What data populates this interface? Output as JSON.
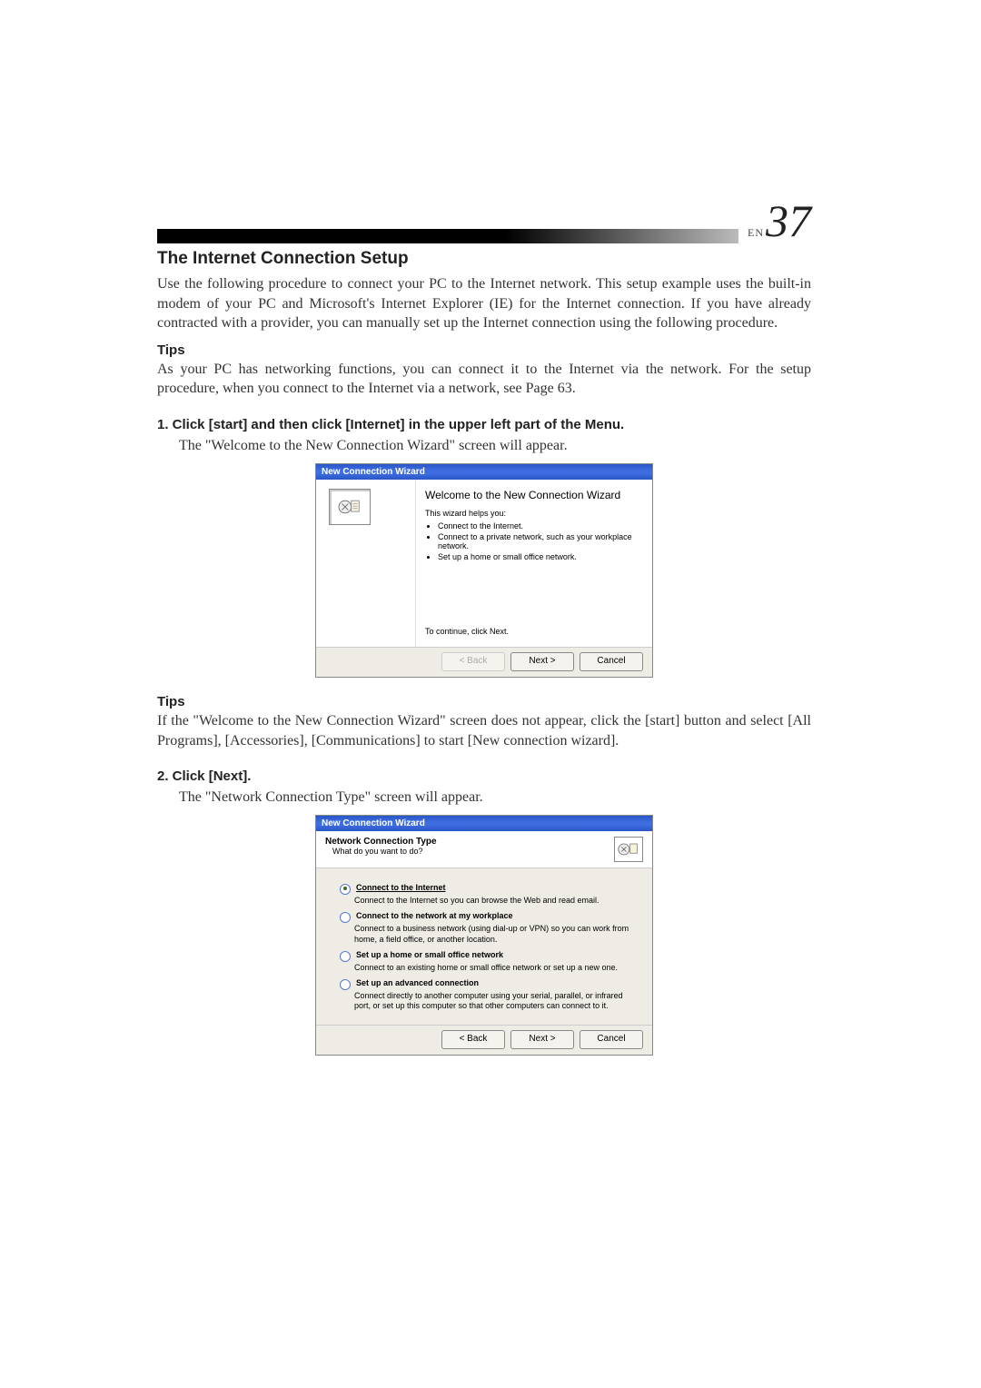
{
  "page": {
    "lang_prefix": "EN",
    "number": "37"
  },
  "section_title": "The Internet Connection Setup",
  "intro": "Use the following procedure to connect your PC to the Internet network.  This setup example uses the built-in modem of your PC and Microsoft's Internet Explorer (IE) for the Internet connection. If you have already contracted with a provider, you can manually set up the Internet connection using the following procedure.",
  "tips1": {
    "head": "Tips",
    "body": "As your PC has networking functions, you can connect it to the Internet via the network.  For the setup procedure, when you connect to the Internet via a network, see Page  63."
  },
  "step1": {
    "head": "1.  Click [start] and then click [Internet] in the upper left part of the Menu.",
    "body": "The \"Welcome to the New Connection Wizard\" screen will appear."
  },
  "wizard1": {
    "titlebar": "New Connection Wizard",
    "heading": "Welcome to the New Connection Wizard",
    "lead": "This wizard helps you:",
    "bullets": [
      "Connect to the Internet.",
      "Connect to a private network, such as your workplace network.",
      "Set up a home or small office network."
    ],
    "continue_line": "To continue, click Next.",
    "buttons": {
      "back": "< Back",
      "next": "Next >",
      "cancel": "Cancel"
    }
  },
  "tips2": {
    "head": "Tips",
    "body": "If the \"Welcome to the New Connection Wizard\" screen does not appear, click the [start] button and select [All Programs], [Accessories], [Communications] to start [New connection wizard]."
  },
  "step2": {
    "head": "2.  Click [Next].",
    "body": "The \"Network Connection Type\" screen will appear."
  },
  "wizard2": {
    "titlebar": "New Connection Wizard",
    "header_title": "Network Connection Type",
    "header_sub": "What do you want to do?",
    "options": [
      {
        "label": "Connect to the Internet",
        "selected": true,
        "link_style": true,
        "desc": "Connect to the Internet so you can browse the Web and read email."
      },
      {
        "label": "Connect to the network at my workplace",
        "selected": false,
        "link_style": false,
        "desc": "Connect to a business network (using dial-up or VPN) so you can work from home, a field office, or another location."
      },
      {
        "label": "Set up a home or small office network",
        "selected": false,
        "link_style": false,
        "desc": "Connect to an existing home or small office network or set up a new one."
      },
      {
        "label": "Set up an advanced connection",
        "selected": false,
        "link_style": false,
        "desc": "Connect directly to another computer using your serial, parallel, or infrared port, or set up this computer so that other computers can connect to it."
      }
    ],
    "buttons": {
      "back": "< Back",
      "next": "Next >",
      "cancel": "Cancel"
    }
  }
}
